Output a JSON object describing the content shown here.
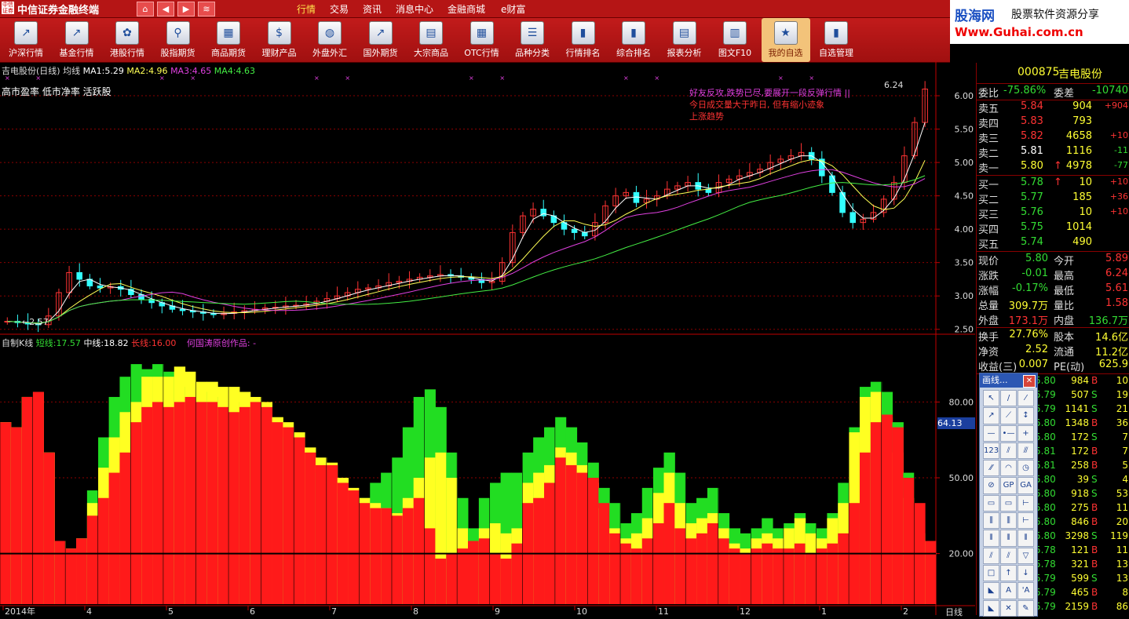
{
  "app": {
    "title": "中信证券金融终端",
    "logo_text": "中信证券"
  },
  "nav_buttons": [
    "⌂",
    "◀",
    "▶",
    "≋"
  ],
  "menu": [
    {
      "label": "行情",
      "active": true
    },
    {
      "label": "交易",
      "active": false
    },
    {
      "label": "资讯",
      "active": false
    },
    {
      "label": "消息中心",
      "active": false
    },
    {
      "label": "金融商城",
      "active": false
    },
    {
      "label": "e财富",
      "active": false
    }
  ],
  "toolbar": [
    {
      "label": "沪深行情",
      "icon": "chart-up-icon",
      "glyph": "↗"
    },
    {
      "label": "基金行情",
      "icon": "fund-chart-icon",
      "glyph": "↗"
    },
    {
      "label": "港股行情",
      "icon": "hk-flower-icon",
      "glyph": "✿"
    },
    {
      "label": "股指期货",
      "icon": "magnifier-icon",
      "glyph": "⚲"
    },
    {
      "label": "商品期货",
      "icon": "gold-bars-icon",
      "glyph": "▦"
    },
    {
      "label": "理财产品",
      "icon": "money-icon",
      "glyph": "$"
    },
    {
      "label": "外盘外汇",
      "icon": "globe-icon",
      "glyph": "◍"
    },
    {
      "label": "国外期货",
      "icon": "foreign-chart-icon",
      "glyph": "↗"
    },
    {
      "label": "大宗商品",
      "icon": "commodity-icon",
      "glyph": "▤"
    },
    {
      "label": "OTC行情",
      "icon": "otc-grid-icon",
      "glyph": "▦"
    },
    {
      "label": "品种分类",
      "icon": "category-icon",
      "glyph": "☰"
    },
    {
      "label": "行情排名",
      "icon": "ranking-icon",
      "glyph": "▮"
    },
    {
      "label": "综合排名",
      "icon": "overall-rank-icon",
      "glyph": "▮"
    },
    {
      "label": "报表分析",
      "icon": "report-icon",
      "glyph": "▤"
    },
    {
      "label": "图文F10",
      "icon": "f10-icon",
      "glyph": "▥"
    },
    {
      "label": "我的自选",
      "icon": "favorites-icon",
      "glyph": "★",
      "active": true
    },
    {
      "label": "自选管理",
      "icon": "manage-icon",
      "glyph": "▮"
    }
  ],
  "ad": {
    "site": "股海网",
    "slogan": "股票软件资源分享",
    "url": "Www.Guhai.com.cn"
  },
  "chart": {
    "header": "吉电股份(日线) 均线",
    "ma": [
      {
        "label": "MA1:",
        "value": "5.29",
        "color": "#ffffff"
      },
      {
        "label": "MA2:",
        "value": "4.96",
        "color": "#ffff55"
      },
      {
        "label": "MA3:",
        "value": "4.65",
        "color": "#e040e0"
      },
      {
        "label": "MA4:",
        "value": "4.63",
        "color": "#44ee44"
      }
    ],
    "tags": "高市盈率 低市净率 活跃股",
    "notes": [
      "好友反攻,跌势已尽,要展开一段反弹行情 ||",
      "今日成交量大于昨日, 但有缩小迹象",
      "上涨趋势"
    ],
    "high_label": "6.24",
    "low_label": "2.57",
    "price_ticks": [
      "6.00",
      "5.50",
      "5.00",
      "4.50",
      "4.00",
      "3.50",
      "3.00",
      "2.50"
    ],
    "indicator_header": "自制K线",
    "indicator_lines": [
      {
        "label": "短线:",
        "value": "17.57",
        "color": "#33dd33"
      },
      {
        "label": "中线:",
        "value": "18.82",
        "color": "#ffffff"
      },
      {
        "label": "长线:",
        "value": "16.00",
        "color": "#ff3333"
      }
    ],
    "indicator_author": "何国涛原创作品: -",
    "indicator_ticks": [
      "80.00",
      "50.00",
      "20.00"
    ],
    "cursor_value": "64.13",
    "months": [
      "2014年",
      "4",
      "5",
      "6",
      "7",
      "8",
      "9",
      "10",
      "11",
      "12",
      "1",
      "2"
    ],
    "period": "日线",
    "colors": {
      "up": "#ff3333",
      "down": "#33ffff",
      "grid": "#8b0000"
    }
  },
  "chart_data": {
    "type": "candlestick+area",
    "title": "吉电股份(日线)",
    "price_range": [
      2.45,
      6.4
    ],
    "price_series": [
      2.62,
      2.6,
      2.58,
      2.57,
      2.7,
      3.05,
      3.35,
      3.25,
      3.15,
      3.12,
      3.14,
      3.1,
      3.02,
      2.95,
      2.9,
      2.85,
      2.8,
      2.78,
      2.76,
      2.74,
      2.72,
      2.74,
      2.76,
      2.78,
      2.8,
      2.82,
      2.83,
      2.85,
      2.86,
      2.88,
      2.92,
      2.96,
      3.0,
      3.05,
      3.1,
      3.12,
      3.15,
      3.2,
      3.22,
      3.25,
      3.28,
      3.3,
      3.32,
      3.3,
      3.28,
      3.25,
      3.2,
      3.22,
      3.5,
      3.95,
      4.2,
      4.3,
      4.2,
      4.1,
      4.0,
      3.95,
      3.9,
      4.1,
      4.35,
      4.5,
      4.55,
      4.4,
      4.45,
      4.5,
      4.6,
      4.65,
      4.7,
      4.6,
      4.55,
      4.7,
      4.75,
      4.8,
      4.85,
      4.9,
      5.0,
      5.05,
      5.1,
      5.15,
      5.05,
      4.8,
      4.55,
      4.25,
      4.1,
      4.15,
      4.25,
      4.45,
      4.7,
      5.1,
      5.6,
      6.1
    ],
    "ma_series": [
      {
        "name": "MA1",
        "value": 5.29
      },
      {
        "name": "MA2",
        "value": 4.96
      },
      {
        "name": "MA3",
        "value": 4.65
      },
      {
        "name": "MA4",
        "value": 4.63
      }
    ],
    "indicator_range": [
      0,
      100
    ],
    "indicator_series": {
      "red": [
        72,
        70,
        82,
        84,
        60,
        25,
        22,
        26,
        35,
        42,
        52,
        60,
        72,
        78,
        80,
        78,
        80,
        82,
        80,
        80,
        78,
        76,
        78,
        80,
        78,
        72,
        70,
        66,
        60,
        55,
        55,
        48,
        45,
        40,
        38,
        38,
        35,
        38,
        42,
        30,
        18,
        20,
        22,
        25,
        26,
        20,
        18,
        24,
        40,
        42,
        48,
        58,
        55,
        52,
        50,
        40,
        28,
        24,
        22,
        26,
        32,
        40,
        30,
        26,
        28,
        32,
        26,
        22,
        20,
        22,
        24,
        22,
        22,
        24,
        20,
        22,
        24,
        28,
        40,
        60,
        72,
        75,
        70,
        50,
        40,
        25
      ],
      "yellow": [
        72,
        70,
        82,
        84,
        60,
        25,
        22,
        26,
        40,
        54,
        66,
        76,
        80,
        90,
        90,
        90,
        94,
        92,
        88,
        88,
        86,
        86,
        84,
        82,
        80,
        74,
        72,
        68,
        62,
        58,
        56,
        50,
        46,
        42,
        40,
        38,
        36,
        42,
        50,
        58,
        60,
        50,
        30,
        22,
        30,
        32,
        28,
        30,
        48,
        52,
        55,
        62,
        60,
        55,
        48,
        38,
        30,
        26,
        28,
        34,
        44,
        52,
        40,
        32,
        34,
        36,
        30,
        24,
        22,
        26,
        28,
        26,
        30,
        34,
        28,
        26,
        34,
        40,
        68,
        82,
        84,
        74,
        60,
        42,
        25
      ],
      "green": [
        72,
        70,
        82,
        84,
        60,
        25,
        22,
        26,
        45,
        66,
        82,
        90,
        95,
        93,
        95,
        92,
        90,
        86,
        84,
        84,
        82,
        80,
        80,
        78,
        74,
        70,
        66,
        60,
        56,
        52,
        48,
        44,
        42,
        42,
        48,
        52,
        58,
        70,
        82,
        85,
        78,
        60,
        42,
        30,
        42,
        48,
        52,
        52,
        60,
        66,
        70,
        74,
        70,
        64,
        56,
        46,
        40,
        32,
        36,
        46,
        54,
        60,
        52,
        40,
        42,
        46,
        36,
        30,
        28,
        30,
        34,
        30,
        32,
        36,
        32,
        30,
        36,
        48,
        70,
        86,
        88,
        84,
        72,
        52,
        28
      ]
    },
    "indicator_values": {
      "短线": 17.57,
      "中线": 18.82,
      "长线": 16.0
    },
    "x_labels": [
      "2014年",
      "4",
      "5",
      "6",
      "7",
      "8",
      "9",
      "10",
      "11",
      "12",
      "1",
      "2"
    ]
  },
  "quote": {
    "code": "000875",
    "name": "吉电股份",
    "weibi_label": "委比",
    "weibi": "-75.86%",
    "weicha_label": "委差",
    "weicha": "-10740",
    "sells": [
      {
        "label": "卖五",
        "price": "5.84",
        "vol": "904",
        "chg": "+904",
        "color": "#ff3333"
      },
      {
        "label": "卖四",
        "price": "5.83",
        "vol": "793",
        "chg": "",
        "color": "#ff3333"
      },
      {
        "label": "卖三",
        "price": "5.82",
        "vol": "4658",
        "chg": "+10",
        "color": "#ff3333"
      },
      {
        "label": "卖二",
        "price": "5.81",
        "vol": "1116",
        "chg": "-11",
        "color": "#ffffff"
      },
      {
        "label": "卖一",
        "price": "5.80",
        "vol": "4978",
        "chg": "-77",
        "color": "#ffff33",
        "arrow": "↑"
      }
    ],
    "buys": [
      {
        "label": "买一",
        "price": "5.78",
        "vol": "10",
        "chg": "+10",
        "color": "#33dd33",
        "arrow": "↑"
      },
      {
        "label": "买二",
        "price": "5.77",
        "vol": "185",
        "chg": "+36",
        "color": "#33dd33"
      },
      {
        "label": "买三",
        "price": "5.76",
        "vol": "10",
        "chg": "+10",
        "color": "#33dd33"
      },
      {
        "label": "买四",
        "price": "5.75",
        "vol": "1014",
        "chg": "",
        "color": "#33dd33"
      },
      {
        "label": "买五",
        "price": "5.74",
        "vol": "490",
        "chg": "",
        "color": "#33dd33"
      }
    ],
    "stats": [
      {
        "l1": "现价",
        "v1": "5.80",
        "c1": "#33dd33",
        "l2": "今开",
        "v2": "5.89",
        "c2": "#ff3333"
      },
      {
        "l1": "涨跌",
        "v1": "-0.01",
        "c1": "#33dd33",
        "l2": "最高",
        "v2": "6.24",
        "c2": "#ff3333"
      },
      {
        "l1": "涨幅",
        "v1": "-0.17%",
        "c1": "#33dd33",
        "l2": "最低",
        "v2": "5.61",
        "c2": "#ff3333"
      },
      {
        "l1": "总量",
        "v1": "309.7万",
        "c1": "#ffff33",
        "l2": "量比",
        "v2": "1.58",
        "c2": "#ff3333"
      },
      {
        "l1": "外盘",
        "v1": "173.1万",
        "c1": "#ff3333",
        "l2": "内盘",
        "v2": "136.7万",
        "c2": "#33dd33"
      },
      {
        "l1": "换手",
        "v1": "27.76%",
        "c1": "#ffff33",
        "l2": "股本",
        "v2": "14.6亿",
        "c2": "#ffff33"
      },
      {
        "l1": "净资",
        "v1": "2.52",
        "c1": "#ffff33",
        "l2": "流通",
        "v2": "11.2亿",
        "c2": "#ffff33"
      },
      {
        "l1": "收益(三)",
        "v1": "0.007",
        "c1": "#ffff33",
        "l2": "PE(动)",
        "v2": "625.9",
        "c2": "#ffff33"
      }
    ],
    "ticks": [
      {
        "p": "5.80",
        "v": "984",
        "bs": "B",
        "n": "10"
      },
      {
        "p": "5.79",
        "v": "507",
        "bs": "S",
        "n": "19"
      },
      {
        "p": "5.79",
        "v": "1141",
        "bs": "S",
        "n": "21"
      },
      {
        "p": "5.80",
        "v": "1348",
        "bs": "B",
        "n": "36"
      },
      {
        "p": "5.80",
        "v": "172",
        "bs": "S",
        "n": "7"
      },
      {
        "p": "5.81",
        "v": "172",
        "bs": "B",
        "n": "7"
      },
      {
        "p": "5.81",
        "v": "258",
        "bs": "B",
        "n": "5"
      },
      {
        "p": "5.80",
        "v": "39",
        "bs": "S",
        "n": "4"
      },
      {
        "p": "5.80",
        "v": "918",
        "bs": "S",
        "n": "53"
      },
      {
        "p": "5.80",
        "v": "275",
        "bs": "B",
        "n": "11"
      },
      {
        "p": "5.80",
        "v": "846",
        "bs": "B",
        "n": "20"
      },
      {
        "p": "5.80",
        "v": "3298",
        "bs": "S",
        "n": "119"
      },
      {
        "p": "5.78",
        "v": "121",
        "bs": "B",
        "n": "11"
      },
      {
        "p": "5.78",
        "v": "321",
        "bs": "B",
        "n": "13"
      },
      {
        "p": "5.79",
        "v": "599",
        "bs": "S",
        "n": "13"
      },
      {
        "p": "5.79",
        "v": "465",
        "bs": "B",
        "n": "8"
      },
      {
        "p": "5.79",
        "v": "2159",
        "bs": "B",
        "n": "86"
      }
    ]
  },
  "draw_window": {
    "title": "画线...",
    "close": "✕",
    "tools": [
      "↖",
      "/",
      "⁄",
      "↗",
      "⟋",
      "↕",
      "—",
      "•—",
      "+",
      "123",
      "⫽",
      "⫻",
      "⁄⁄",
      "◠",
      "◷",
      "⊘",
      "GP",
      "GA",
      "▭",
      "▭",
      "⊢",
      "⫼",
      "⫼",
      "⊢",
      "⦀",
      "⦀",
      "⦀",
      "⫽",
      "⫽",
      "▽",
      "□",
      "↑",
      "↓",
      "◣",
      "A",
      "'A",
      "◣",
      "✕",
      "✎"
    ]
  }
}
